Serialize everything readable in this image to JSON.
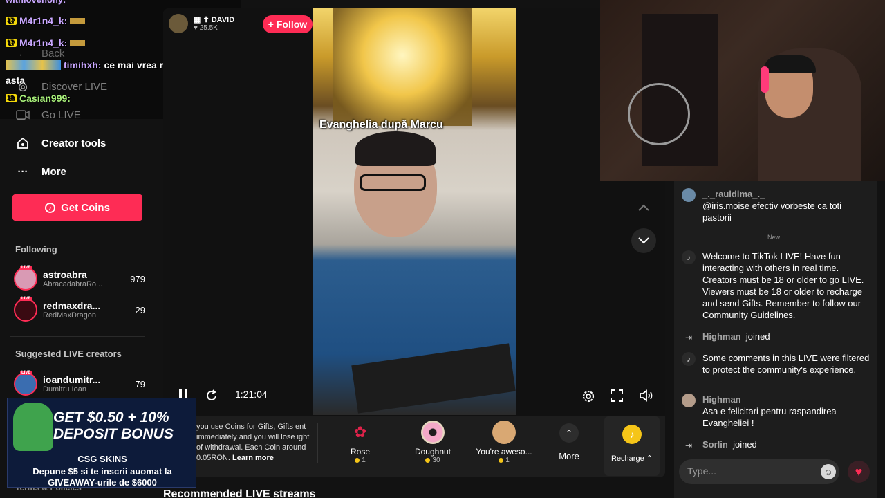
{
  "sidebar": {
    "back_label": "Back",
    "discover_label": "Discover LIVE",
    "go_live_label": "Go LIVE",
    "creator_tools_label": "Creator tools",
    "more_label": "More",
    "get_coins_label": "Get Coins",
    "following_title": "Following",
    "following": [
      {
        "name": "astroabra",
        "sub": "AbracadabraRo...",
        "count": "979"
      },
      {
        "name": "redmaxdra...",
        "sub": "RedMaxDragon",
        "count": "29"
      }
    ],
    "suggested_title": "Suggested LIVE creators",
    "suggested": [
      {
        "name": "ioandumitr...",
        "sub": "Dumitru Ioan",
        "count": "79"
      }
    ],
    "footer_text": "Terms & Policies"
  },
  "stream_chat": [
    {
      "badge": "17",
      "user": "M4r1n4_k:",
      "text": "",
      "color": "purple"
    },
    {
      "badge": "17",
      "user": "M4r1n4_k:",
      "text": "",
      "color": "purple"
    },
    {
      "badge": "",
      "user": "timihxh:",
      "text": "ce mai vrea ma si pocaitu",
      "color": "purple"
    },
    {
      "badge": "",
      "user": "",
      "text": "asta",
      "color": "white"
    },
    {
      "badge": "18",
      "user": "Casian999:",
      "text": "",
      "color": "green"
    }
  ],
  "host": {
    "name": "DAVID",
    "likes": "25.5K",
    "follow_label": "+ Follow"
  },
  "video": {
    "caption": "Evanghelia după Marcu",
    "time": "1:21:04"
  },
  "gifts": {
    "info_text": "you use Coins for Gifts, Gifts ent immediately and you will lose ight of withdrawal. Each Coin around 0.05RON.",
    "learn_more": "Learn more",
    "items": [
      {
        "name": "Rose",
        "price": "1",
        "icon": "rose-icon"
      },
      {
        "name": "Doughnut",
        "price": "30",
        "icon": "doughnut-icon"
      },
      {
        "name": "You're aweso...",
        "price": "1",
        "icon": "hamster-icon"
      }
    ],
    "more_label": "More",
    "recharge_label": "Recharge"
  },
  "recommended_title": "Recommended LIVE streams",
  "ad": {
    "headline_1": "GET $0.50 + 10%",
    "headline_2": "DEPOSIT BONUS",
    "brand": "CSG SKINS",
    "line_1": "Depune $5 si te inscrii auomat la",
    "line_2": "GIVEAWAY-urile de $6000"
  },
  "chat": {
    "messages": [
      {
        "user": "_._rauldima_._",
        "text": "@iris.moise efectiv vorbeste ca toti pastorii",
        "icon": "avatar"
      },
      {
        "user": "",
        "text": "Welcome to TikTok LIVE! Have fun interacting with others in real time. Creators must be 18 or older to go LIVE. Viewers must be 18 or older to recharge and send Gifts. Remember to follow our Community Guidelines.",
        "icon": "tiktok-icon"
      },
      {
        "user": "Highman",
        "text": "joined",
        "icon": "join-icon"
      },
      {
        "user": "",
        "text": "Some comments in this LIVE were filtered to protect the community's experience.",
        "icon": "tiktok-icon"
      },
      {
        "user": "Highman",
        "text": "Asa e felicitari pentru raspandirea Evangheliei !",
        "icon": "avatar"
      },
      {
        "user": "Sorlin",
        "text": "joined",
        "icon": "join-icon"
      }
    ],
    "new_separator": "New",
    "input_placeholder": "Type..."
  },
  "colors": {
    "accent": "#fe2c55",
    "bg": "#121212",
    "panel": "#1d1d1d"
  }
}
